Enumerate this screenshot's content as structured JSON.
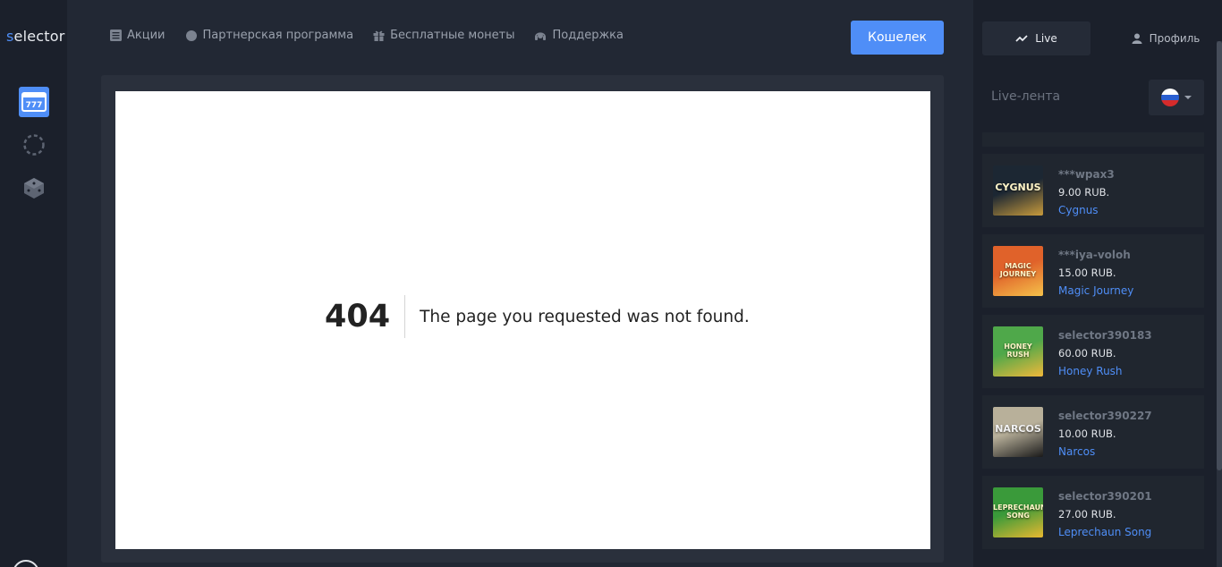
{
  "brand": {
    "first_letter": "s",
    "rest": "elector"
  },
  "nav": {
    "items": [
      {
        "label": "Акции",
        "icon": "list-icon"
      },
      {
        "label": "Партнерская программа",
        "icon": "partner-icon"
      },
      {
        "label": "Бесплатные монеты",
        "icon": "gift-icon"
      },
      {
        "label": "Поддержка",
        "icon": "support-icon"
      }
    ],
    "wallet_label": "Кошелек"
  },
  "rail": {
    "items": [
      {
        "icon": "slots-icon",
        "active": true
      },
      {
        "icon": "spinner-icon",
        "active": false
      },
      {
        "icon": "dice-icon",
        "active": false
      }
    ]
  },
  "error": {
    "code": "404",
    "message": "The page you requested was not found."
  },
  "side": {
    "tabs": [
      {
        "label": "Live",
        "icon": "chart-line-icon",
        "active": true
      },
      {
        "label": "Профиль",
        "icon": "user-icon",
        "active": false
      }
    ],
    "feed_title": "Live-лента",
    "language": "ru",
    "feed": [
      {
        "user": "***wpax3",
        "amount": "9.00 RUB.",
        "game": "Cygnus",
        "thumb_text": "CYGNUS",
        "thumb_colors": [
          "#1c2733",
          "#c89b3c"
        ]
      },
      {
        "user": "***iya-voloh",
        "amount": "15.00 RUB.",
        "game": "Magic Journey",
        "thumb_text": "MAGIC JOURNEY",
        "thumb_colors": [
          "#e0622a",
          "#f5c24a"
        ]
      },
      {
        "user": "selector390183",
        "amount": "60.00 RUB.",
        "game": "Honey Rush",
        "thumb_text": "HONEY RUSH",
        "thumb_colors": [
          "#4fa84a",
          "#f0b83a"
        ]
      },
      {
        "user": "selector390227",
        "amount": "10.00 RUB.",
        "game": "Narcos",
        "thumb_text": "NARCOS",
        "thumb_colors": [
          "#b8b09a",
          "#1a1a1a"
        ]
      },
      {
        "user": "selector390201",
        "amount": "27.00 RUB.",
        "game": "Leprechaun Song",
        "thumb_text": "LEPRECHAUN SONG",
        "thumb_colors": [
          "#3a9a3a",
          "#e8b830"
        ]
      }
    ]
  }
}
